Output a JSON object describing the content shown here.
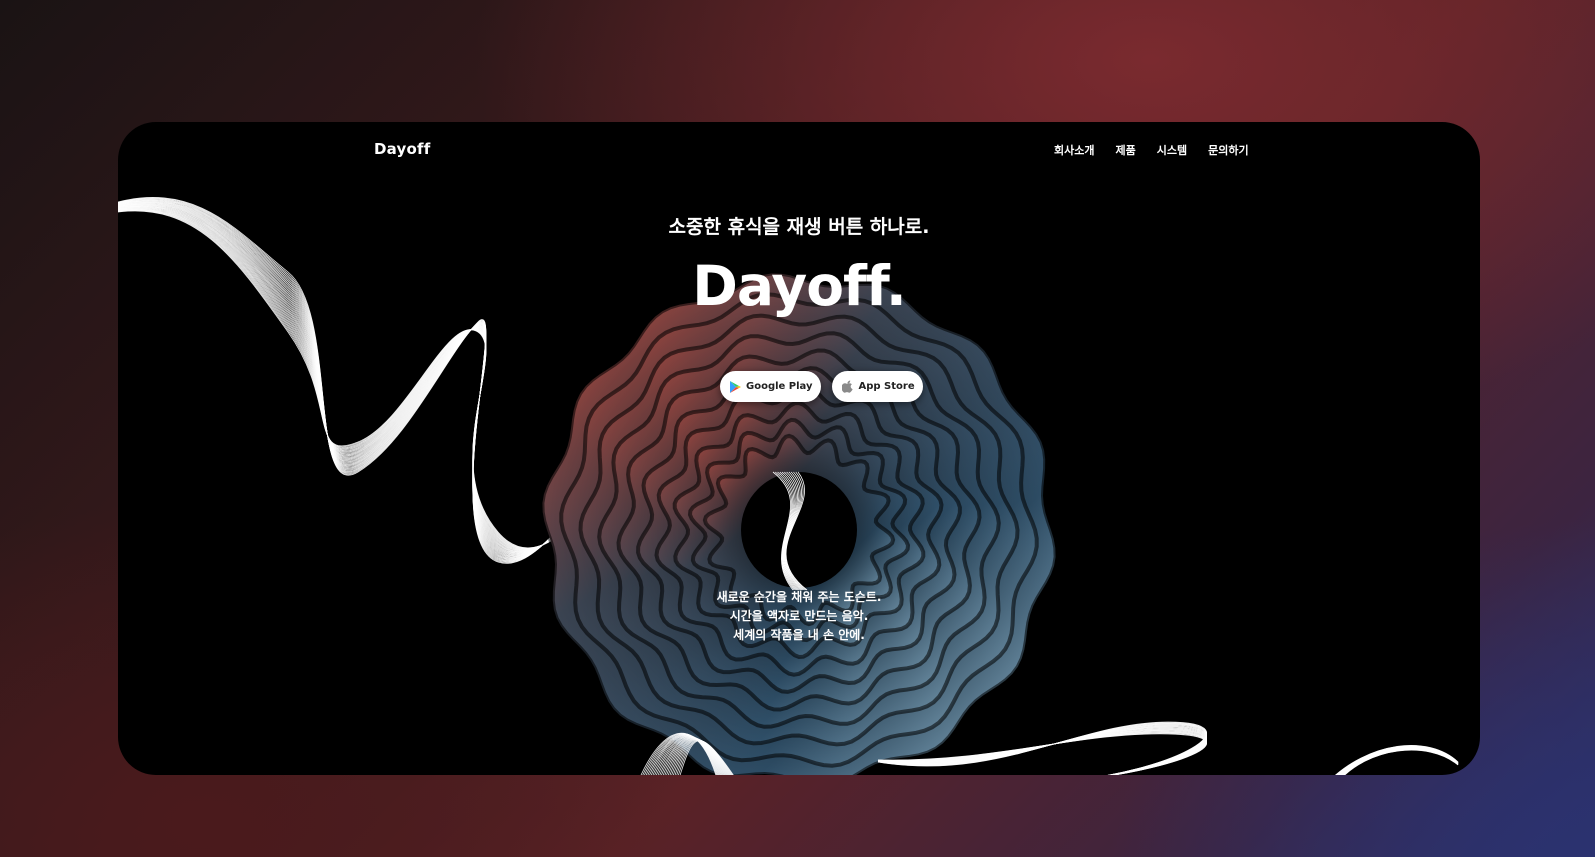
{
  "header": {
    "logo": "Dayoff",
    "nav": [
      "회사소개",
      "제품",
      "시스템",
      "문의하기"
    ]
  },
  "hero": {
    "tagline": "소중한 휴식을 재생 버튼 하나로.",
    "title": "Dayoff.",
    "buttons": {
      "google_play": {
        "label": "Google Play",
        "icon": "google-play-icon"
      },
      "app_store": {
        "label": "App Store",
        "icon": "apple-icon"
      }
    },
    "description": [
      "새로운 순간을 채워 주는 도슨트.",
      "시간을 액자로 만드는 음악.",
      "세계의 작품을 내 손 안에."
    ]
  },
  "colors": {
    "frame_bg": "#000000",
    "text": "#ffffff",
    "accent_red": "#c0392b",
    "accent_blue": "#4a7a99"
  }
}
